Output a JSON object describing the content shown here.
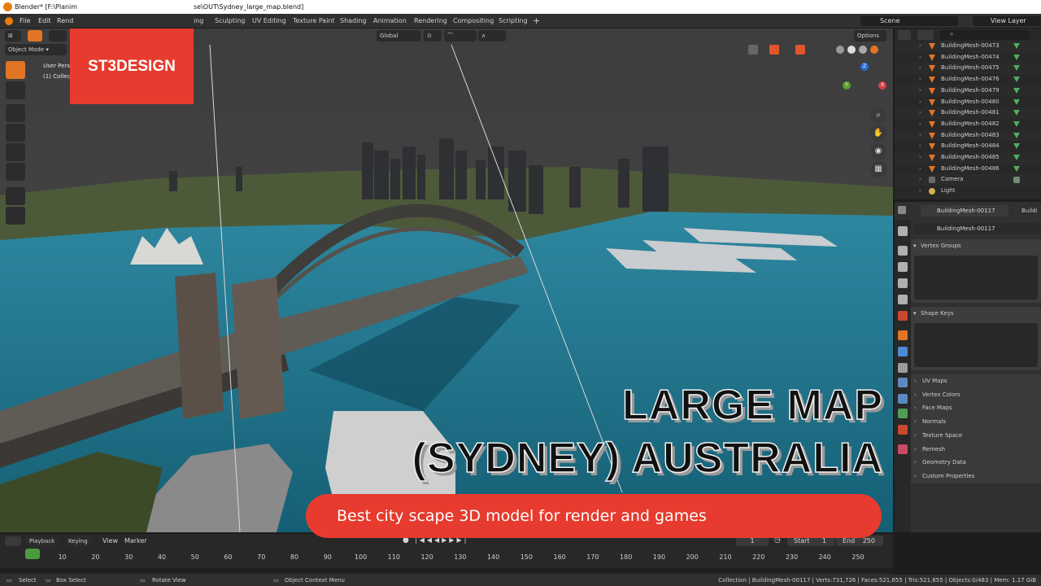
{
  "window": {
    "title": "Blender* [F:\\Planim",
    "title_path": "se\\OUT\\Sydney_large_map.blend]"
  },
  "menubar": {
    "items": [
      "File",
      "Edit",
      "Rend"
    ],
    "workspaces": [
      "ing",
      "Sculpting",
      "UV Editing",
      "Texture Paint",
      "Shading",
      "Animation",
      "Rendering",
      "Compositing",
      "Scripting"
    ],
    "add_tab": "+",
    "scene_label": "Scene",
    "view_layer_label": "View Layer"
  },
  "viewport_header": {
    "mode": "Object Mode",
    "orientation": "Global",
    "options": "Options",
    "overlay_line1": "User Pers",
    "overlay_line2": "(1) Collec"
  },
  "gizmo": {
    "z": "Z",
    "y": "Y",
    "x": "X"
  },
  "outliner": {
    "search_placeholder": "",
    "items": [
      "BuildingMesh-00473",
      "BuildingMesh-00474",
      "BuildingMesh-00475",
      "BuildingMesh-00476",
      "BuildingMesh-00479",
      "BuildingMesh-00480",
      "BuildingMesh-00481",
      "BuildingMesh-00482",
      "BuildingMesh-00483",
      "BuildingMesh-00484",
      "BuildingMesh-00485",
      "BuildingMesh-00486",
      "Camera",
      "Light"
    ]
  },
  "properties": {
    "object_name": "BuildingMesh-00117",
    "object_name_short": "Buildi",
    "mesh_name": "BuildingMesh-00117",
    "panels": [
      "Vertex Groups",
      "Shape Keys"
    ],
    "sub_panels": [
      "UV Maps",
      "Vertex Colors",
      "Face Maps",
      "Normals",
      "Texture Space",
      "Remesh",
      "Geometry Data",
      "Custom Properties"
    ]
  },
  "timeline": {
    "playback": "Playback",
    "keying": "Keying",
    "view": "View",
    "marker": "Marker",
    "current_frame": "1",
    "start_label": "Start",
    "start": "1",
    "end_label": "End",
    "end": "250",
    "ticks": [
      "1",
      "10",
      "20",
      "30",
      "40",
      "50",
      "60",
      "70",
      "80",
      "90",
      "100",
      "110",
      "120",
      "130",
      "140",
      "150",
      "160",
      "170",
      "180",
      "190",
      "200",
      "210",
      "220",
      "230",
      "240",
      "250"
    ]
  },
  "statusbar": {
    "select": "Select",
    "box_select": "Box Select",
    "rotate_view": "Rotate View",
    "context_menu": "Object Context Menu",
    "stats": "Collection | BuildingMesh-00117 | Verts:731,726 | Faces:521,655 | Tris:521,655 | Objects:0/483 | Mem: 1.17 GiB"
  },
  "promo": {
    "brand": "ST3DESIGN",
    "headline_line1": "LARGE MAP",
    "headline_line2": "(SYDNEY) AUSTRALIA",
    "subtitle": "Best city scape 3D model for render and games"
  },
  "colors": {
    "accent_red": "#e63b2e",
    "blender_orange": "#e27525",
    "water": "#1d6f86"
  }
}
